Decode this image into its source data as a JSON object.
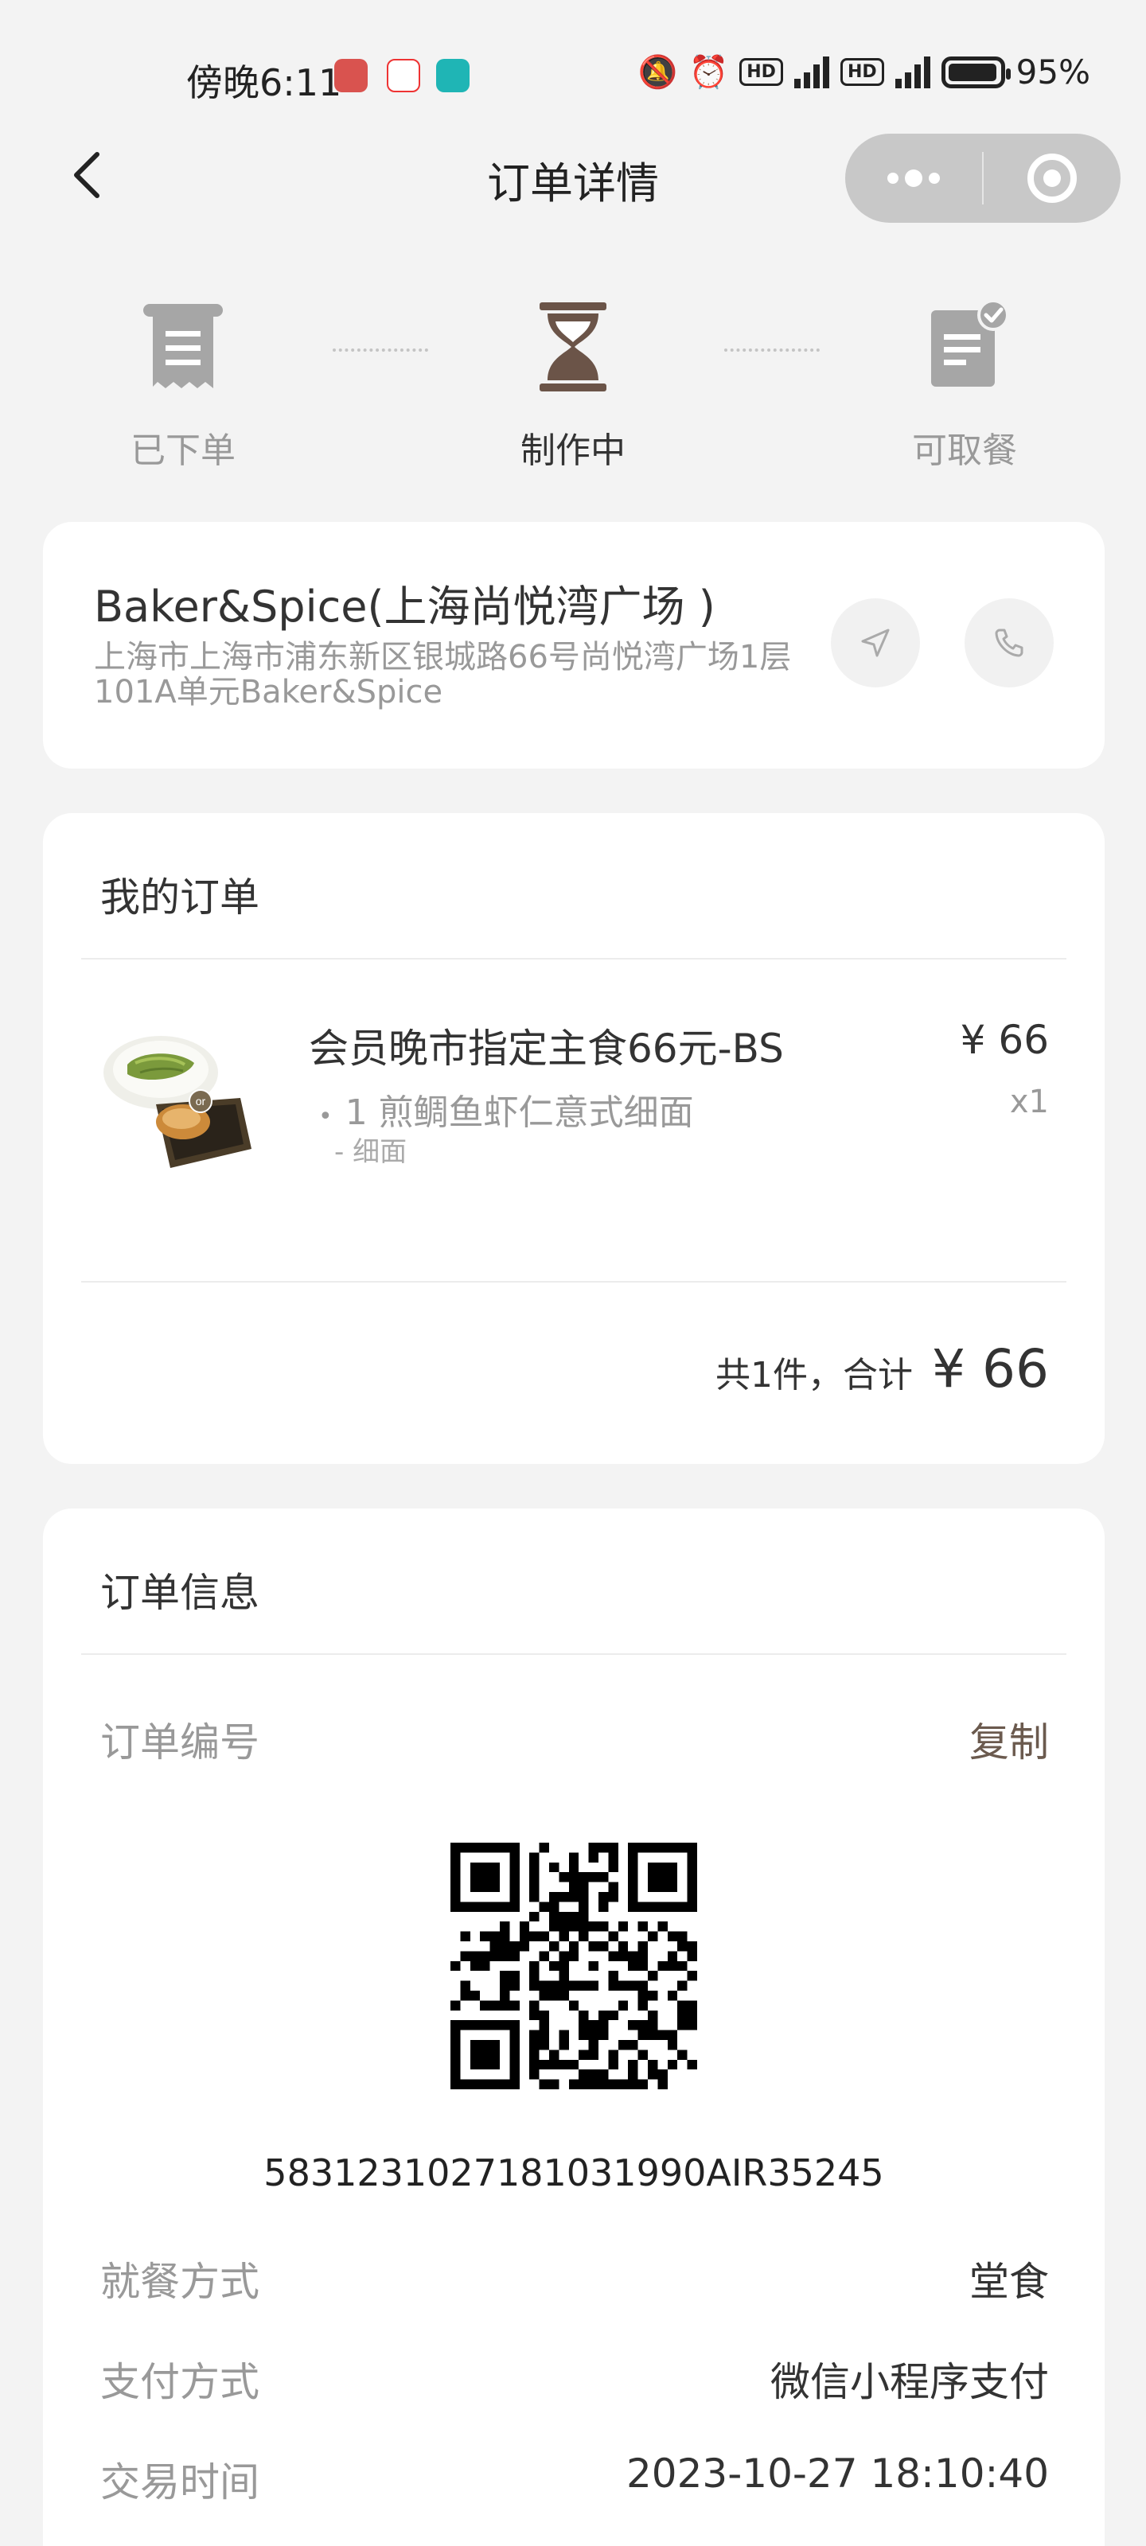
{
  "status_bar": {
    "time": "傍晚6:11",
    "battery": "95%"
  },
  "nav": {
    "title": "订单详情"
  },
  "steps": [
    {
      "label": "已下单",
      "state": "done"
    },
    {
      "label": "制作中",
      "state": "active"
    },
    {
      "label": "可取餐",
      "state": "pending"
    }
  ],
  "store": {
    "name": "Baker&Spice(上海尚悦湾广场 )",
    "address": "上海市上海市浦东新区银城路66号尚悦湾广场1层101A单元Baker&Spice"
  },
  "my_order": {
    "title": "我的订单",
    "item": {
      "name": "会员晚市指定主食66元-BS",
      "price": "¥ 66",
      "sub": "1 煎鲷鱼虾仁意式细面",
      "qty": "x1",
      "note": "- 细面",
      "image_badge": "or"
    },
    "total_label": "共1件，合计",
    "total_value": "¥ 66"
  },
  "order_info": {
    "title": "订单信息",
    "order_no_label": "订单编号",
    "copy_label": "复制",
    "order_no": "5831231027181031990AIR35245",
    "rows": [
      {
        "label": "就餐方式",
        "value": "堂食"
      },
      {
        "label": "支付方式",
        "value": "微信小程序支付"
      },
      {
        "label": "交易时间",
        "value": "2023-10-27 18:10:40"
      }
    ]
  },
  "colors": {
    "step_active": "#6b5448",
    "step_inactive": "#a6a6a6",
    "accent_text": "#6b5a4e",
    "background": "#f3f3f3"
  }
}
